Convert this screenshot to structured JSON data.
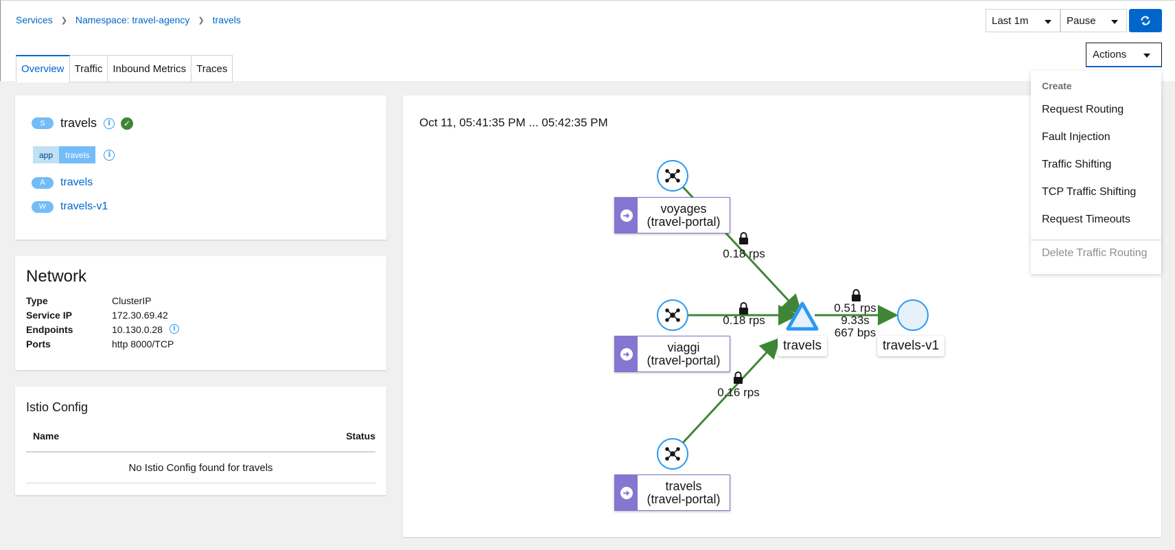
{
  "breadcrumb": {
    "items": [
      "Services",
      "Namespace: travel-agency",
      "travels"
    ]
  },
  "header": {
    "duration": "Last 1m",
    "refresh_mode": "Pause",
    "actions_label": "Actions"
  },
  "tabs": [
    "Overview",
    "Traffic",
    "Inbound Metrics",
    "Traces"
  ],
  "service": {
    "badge": "S",
    "name": "travels",
    "label_key": "app",
    "label_value": "travels",
    "app_badge": "A",
    "app_name": "travels",
    "workload_badge": "W",
    "workload_name": "travels-v1"
  },
  "network": {
    "title": "Network",
    "rows": [
      {
        "key": "Type",
        "value": "ClusterIP"
      },
      {
        "key": "Service IP",
        "value": "172.30.69.42"
      },
      {
        "key": "Endpoints",
        "value": "10.130.0.28"
      },
      {
        "key": "Ports",
        "value": "http 8000/TCP"
      }
    ]
  },
  "istio": {
    "title": "Istio Config",
    "col_name": "Name",
    "col_status": "Status",
    "empty": "No Istio Config found for travels"
  },
  "graph": {
    "time_range": "Oct 11, 05:41:35 PM ... 05:42:35 PM",
    "nodes": {
      "voyages_l1": "voyages",
      "voyages_l2": "(travel-portal)",
      "viaggi_l1": "viaggi",
      "viaggi_l2": "(travel-portal)",
      "travels_portal_l1": "travels",
      "travels_portal_l2": "(travel-portal)",
      "travels_svc": "travels",
      "travels_v1": "travels-v1"
    },
    "edges": {
      "voyages_rps": "0.18 rps",
      "viaggi_rps": "0.18 rps",
      "travels_rps": "0.16 rps",
      "out_rps": "0.51 rps",
      "out_time": "9.33s",
      "out_bps": "667 bps"
    }
  },
  "menu": {
    "group": "Create",
    "items": [
      "Request Routing",
      "Fault Injection",
      "Traffic Shifting",
      "TCP Traffic Shifting",
      "Request Timeouts"
    ],
    "delete": "Delete Traffic Routing"
  },
  "colors": {
    "accent": "#0066cc",
    "edge": "#3e8635",
    "node_purple": "#8476d1",
    "node_blue": "#2b9af3"
  }
}
